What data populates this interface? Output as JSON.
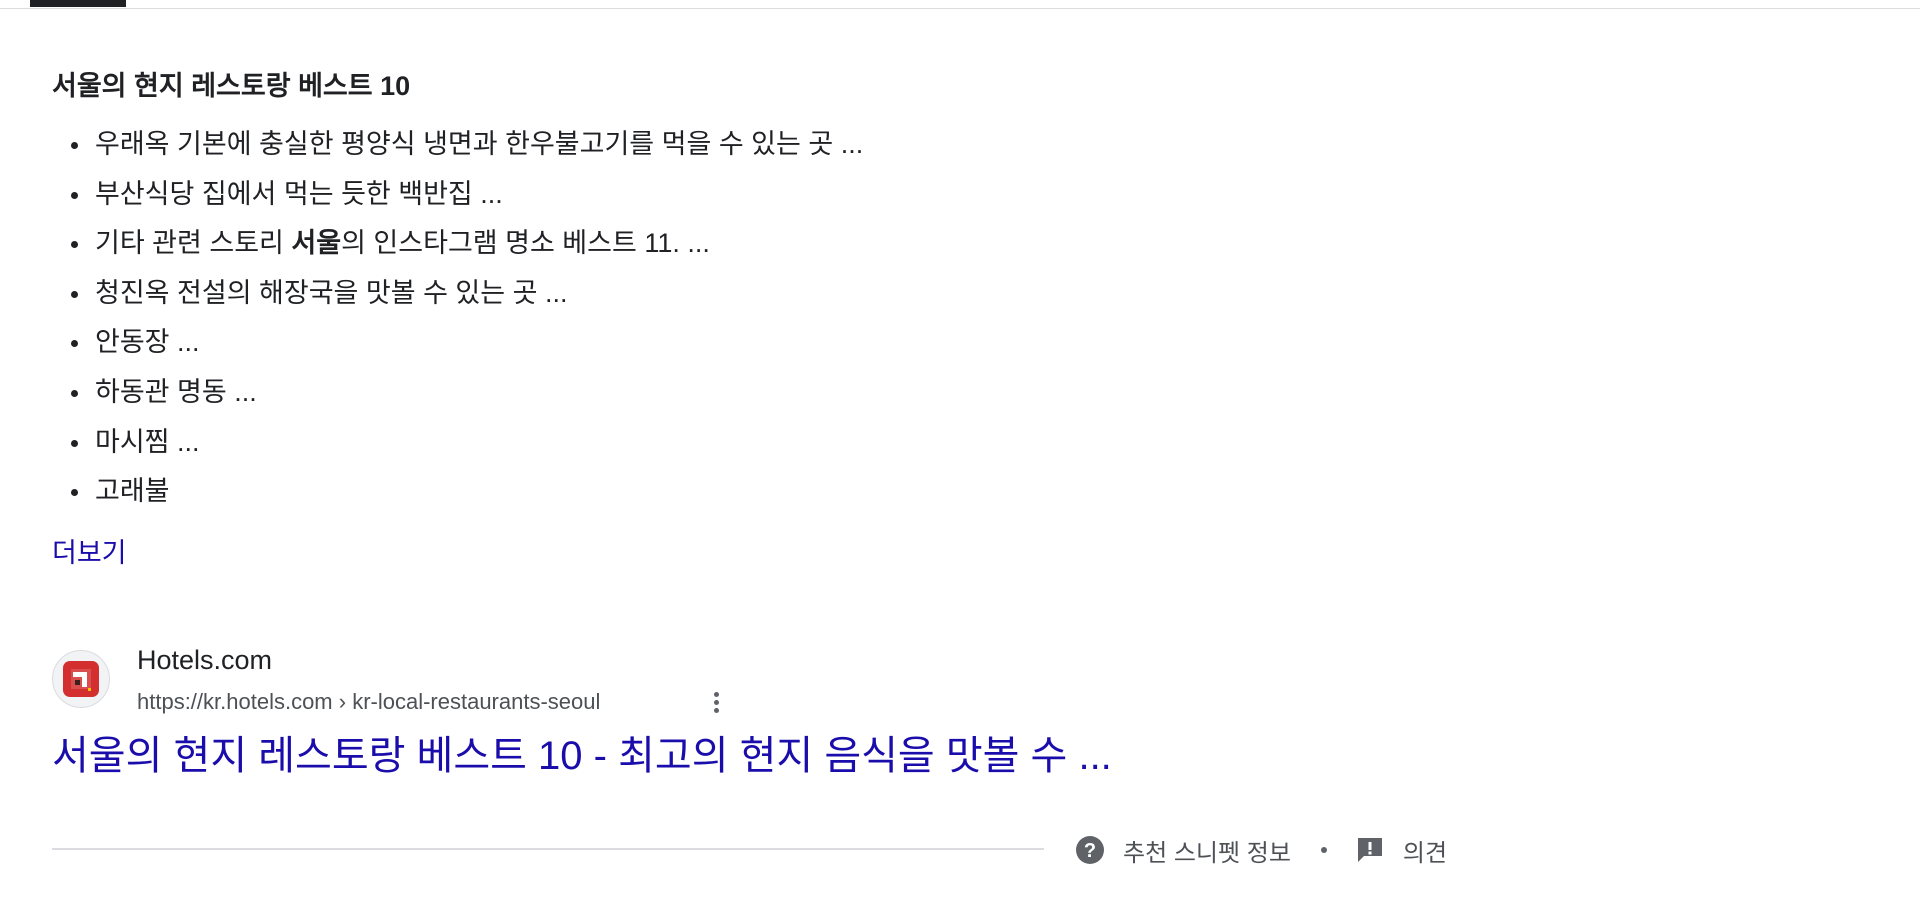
{
  "snippet": {
    "title": "서울의 현지 레스토랑 베스트 10",
    "items": [
      {
        "label": "우래옥 기본에 충실한 평양식 냉면과 한우불고기를 먹을 수 있는 곳 ..."
      },
      {
        "label": "부산식당 집에서 먹는 듯한 백반집 ..."
      },
      {
        "before": "기타 관련 스토리 ",
        "bold": "서울",
        "after": "의 인스타그램 명소 베스트 11. ..."
      },
      {
        "label": "청진옥 전설의 해장국을 맛볼 수 있는 곳 ..."
      },
      {
        "label": "안동장 ..."
      },
      {
        "label": "하동관 명동 ..."
      },
      {
        "label": "마시찜 ..."
      },
      {
        "label": "고래불"
      }
    ],
    "more_label": "더보기"
  },
  "result": {
    "site_name": "Hotels.com",
    "url": "https://kr.hotels.com › kr-local-restaurants-seoul",
    "title": "서울의 현지 레스토랑 베스트 10 - 최고의 현지 음식을 맛볼 수 ...",
    "favicon_icon": "hotels-logo-icon",
    "menu_icon": "more-vert-icon"
  },
  "footer": {
    "about_label": "추천 스니펫 정보",
    "feedback_label": "의견",
    "about_icon": "help-circle-icon",
    "feedback_icon": "feedback-icon"
  },
  "colors": {
    "link": "#1a0dab",
    "text": "#202124",
    "secondary": "#4d5156",
    "favicon_red": "#d32f2f"
  }
}
